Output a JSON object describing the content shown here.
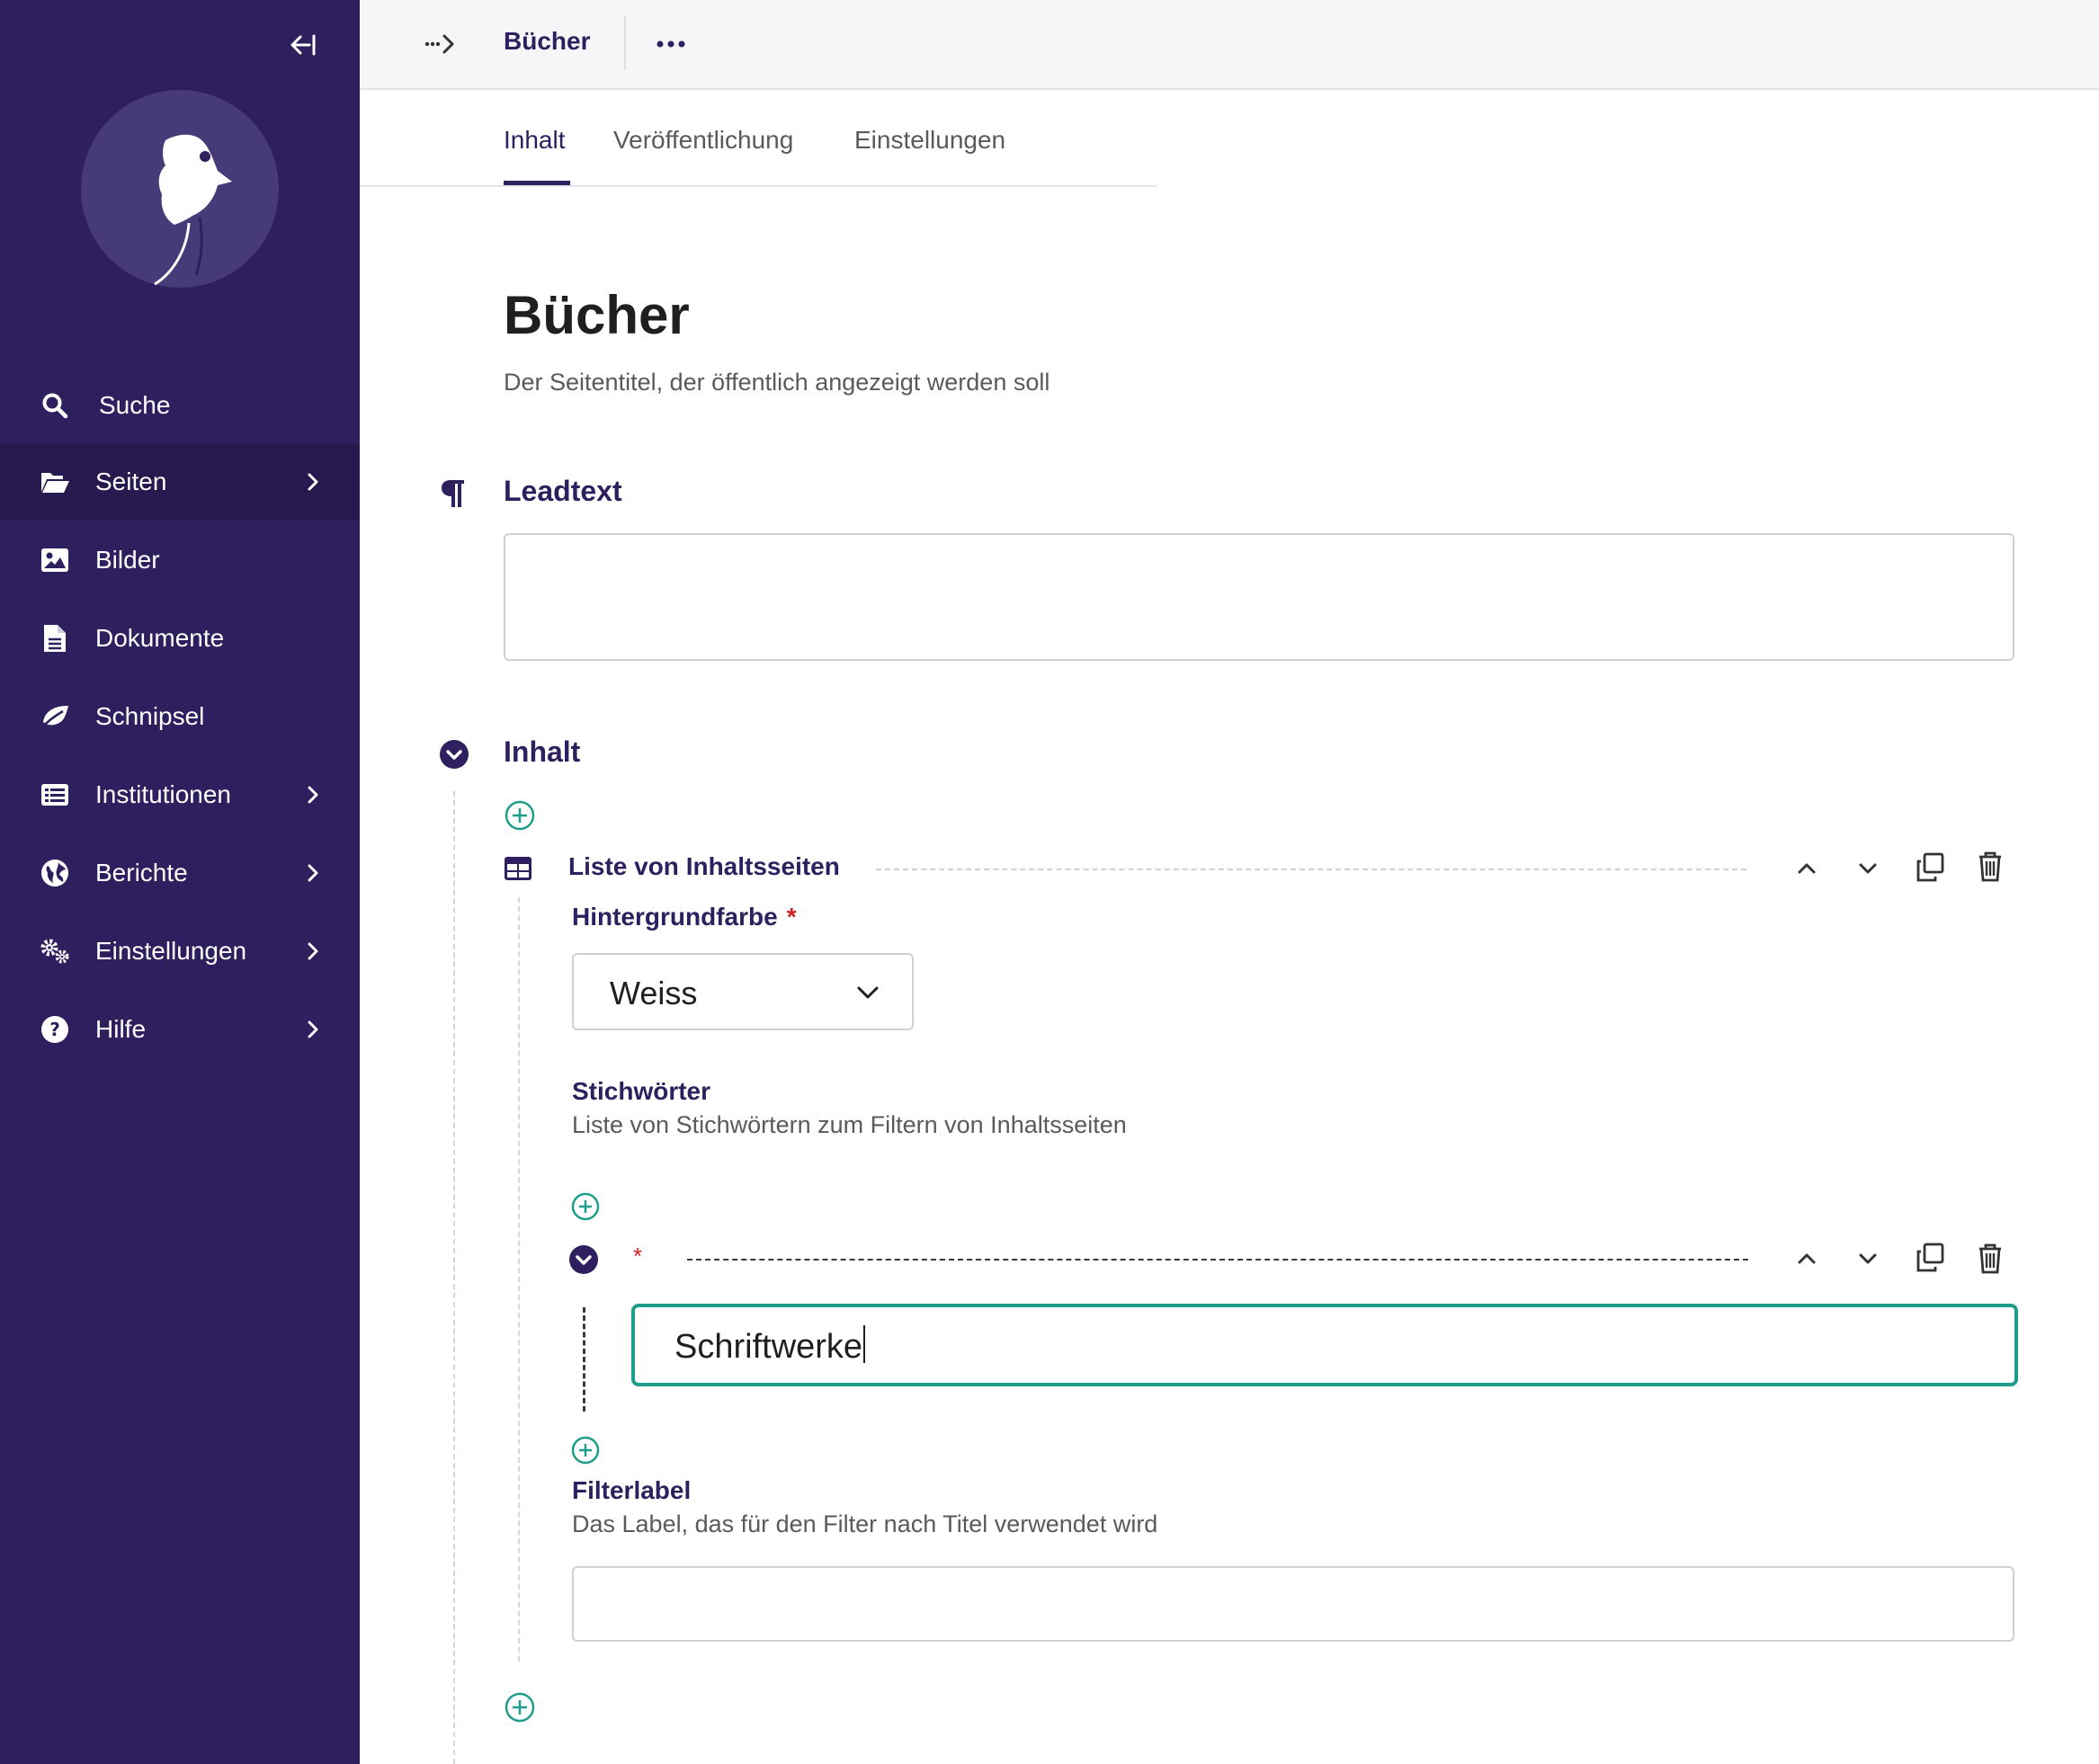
{
  "sidebar": {
    "items": [
      {
        "label": "Suche",
        "icon": "search-icon",
        "has_chevron": false,
        "active": false
      },
      {
        "label": "Seiten",
        "icon": "folder-open-icon",
        "has_chevron": true,
        "active": true
      },
      {
        "label": "Bilder",
        "icon": "image-icon",
        "has_chevron": false,
        "active": false
      },
      {
        "label": "Dokumente",
        "icon": "document-icon",
        "has_chevron": false,
        "active": false
      },
      {
        "label": "Schnipsel",
        "icon": "snippet-icon",
        "has_chevron": false,
        "active": false
      },
      {
        "label": "Institutionen",
        "icon": "list-icon",
        "has_chevron": true,
        "active": false
      },
      {
        "label": "Berichte",
        "icon": "globe-icon",
        "has_chevron": true,
        "active": false
      },
      {
        "label": "Einstellungen",
        "icon": "cogs-icon",
        "has_chevron": true,
        "active": false
      },
      {
        "label": "Hilfe",
        "icon": "help-icon",
        "has_chevron": true,
        "active": false
      }
    ]
  },
  "header": {
    "title": "Bücher"
  },
  "tabs": [
    {
      "label": "Inhalt",
      "active": true
    },
    {
      "label": "Veröffentlichung",
      "active": false
    },
    {
      "label": "Einstellungen",
      "active": false
    }
  ],
  "page": {
    "title": "Bücher",
    "title_help": "Der Seitentitel, der öffentlich angezeigt werden soll",
    "leadtext_label": "Leadtext",
    "leadtext_value": "",
    "content_section_label": "Inhalt",
    "block": {
      "title": "Liste von Inhaltsseiten",
      "background_label": "Hintergrundfarbe",
      "required_mark": "*",
      "background_value": "Weiss",
      "keywords_label": "Stichwörter",
      "keywords_help": "Liste von Stichwörtern zum Filtern von Inhaltsseiten",
      "keyword_item_value": "Schriftwerke",
      "filter_label": "Filterlabel",
      "filter_help": "Das Label, das für den Filter nach Titel verwendet wird",
      "filter_value": ""
    }
  },
  "colors": {
    "sidebar_bg": "#2e1f5e",
    "sidebar_active_bg": "#261a4f",
    "accent": "#2e1f5e",
    "focus": "#1e9e8a",
    "required": "#cd2121"
  }
}
